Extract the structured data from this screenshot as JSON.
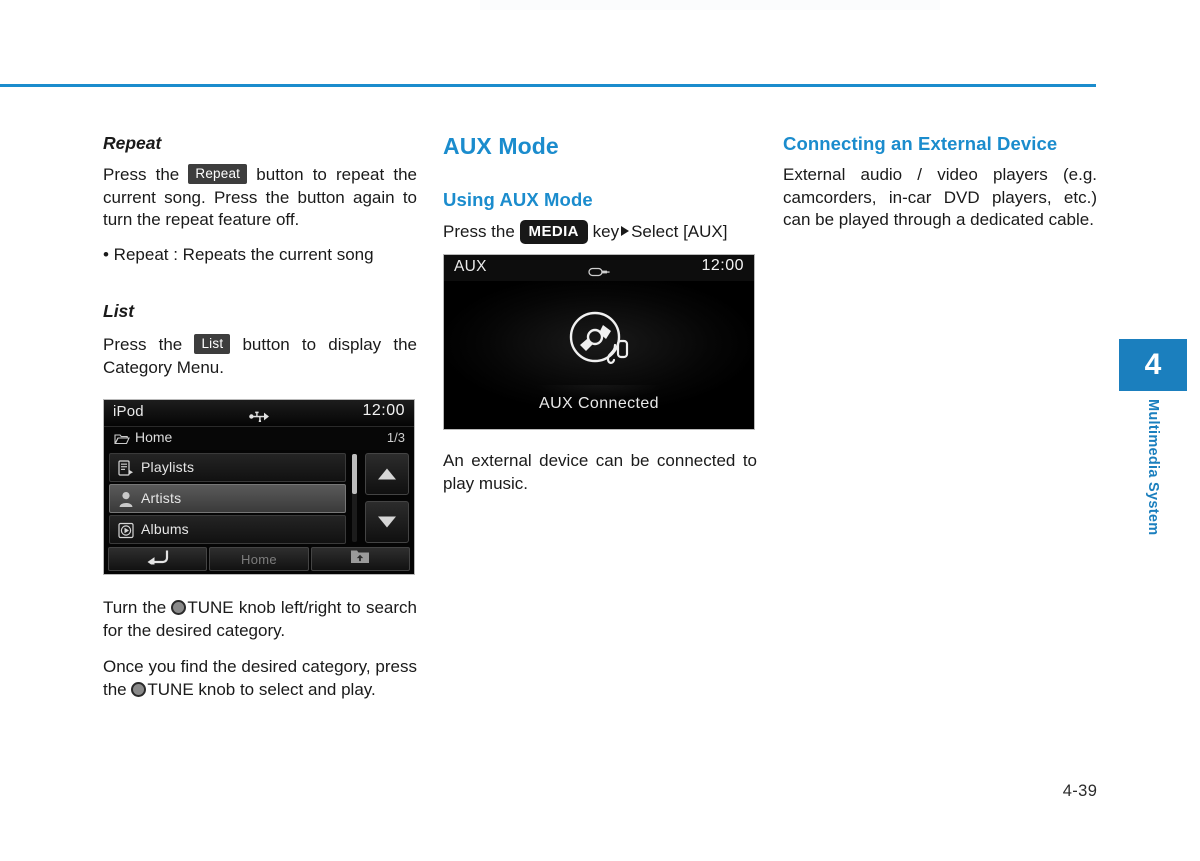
{
  "page": {
    "number": "4-39",
    "chapter_tab": {
      "number": "4",
      "label": "Multimedia System",
      "color": "#1b7fbe"
    },
    "rule_color": "#1b8ccd"
  },
  "left_column": {
    "repeat": {
      "heading": "Repeat",
      "text_before_chip": "Press the",
      "chip": "Repeat",
      "text_after_chip": "button to repeat the current song. Press the button again to turn the repeat feature off.",
      "bullet": "• Repeat : Repeats the current song"
    },
    "list": {
      "heading": "List",
      "text_before_chip": "Press the",
      "chip": "List",
      "text_after_chip": "button to display the Category Menu."
    },
    "ipod_screen": {
      "source": "iPod",
      "clock": "12:00",
      "status_icon": "usb-icon",
      "breadcrumb": "Home",
      "breadcrumb_icon": "folder-open-icon",
      "page_count": "1/3",
      "rows": [
        {
          "label": "Playlists",
          "icon": "playlist-icon",
          "selected": false
        },
        {
          "label": "Artists",
          "icon": "person-icon",
          "selected": true
        },
        {
          "label": "Albums",
          "icon": "album-disc-icon",
          "selected": false
        }
      ],
      "scroll_up": "scroll-up-arrow",
      "scroll_down": "scroll-down-arrow",
      "buttons": [
        {
          "label": "",
          "icon": "back-arrow-icon"
        },
        {
          "label": "Home",
          "icon": ""
        },
        {
          "label": "",
          "icon": "folder-up-icon"
        }
      ]
    },
    "tune_para_1": {
      "a": "Turn the",
      "icon": "tune-knob-icon",
      "b": "TUNE knob left/right to search for the desired category."
    },
    "tune_para_2": {
      "a": "Once you find the desired category, press the",
      "icon": "tune-knob-icon",
      "b": "TUNE knob to select and play."
    }
  },
  "mid_column": {
    "section_title": "AUX Mode",
    "sub_title": "Using AUX Mode",
    "instruction": {
      "a": "Press the",
      "chip": "MEDIA",
      "b": "key",
      "arrow": "play-arrow-icon",
      "c": "Select [AUX]"
    },
    "aux_screen": {
      "source": "AUX",
      "clock": "12:00",
      "status_icon": "aux-plug-icon",
      "graphic_icon": "disc-with-cable-icon",
      "caption": "AUX Connected"
    },
    "note": "An external device can be connected to play music."
  },
  "right_column": {
    "sub_title": "Connecting an External Device",
    "body": "External audio / video players (e.g. camcorders, in-car DVD players, etc.) can be played through a dedicated cable."
  }
}
